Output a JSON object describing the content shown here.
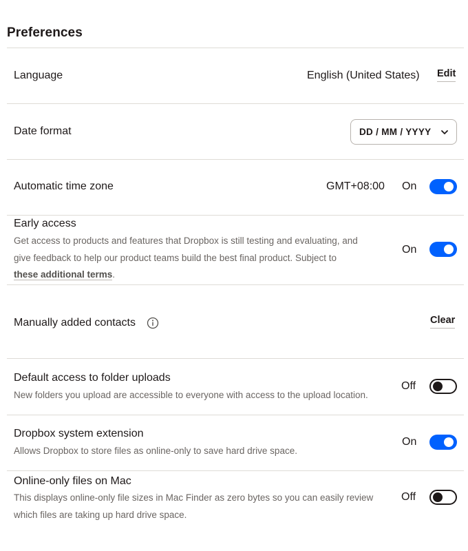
{
  "title": "Preferences",
  "language": {
    "label": "Language",
    "value": "English (United States)",
    "edit_label": "Edit"
  },
  "date_format": {
    "label": "Date format",
    "selected": "DD / MM / YYYY"
  },
  "time_zone": {
    "label": "Automatic time zone",
    "value": "GMT+08:00",
    "state": "On",
    "enabled": true
  },
  "early_access": {
    "label": "Early access",
    "desc_line1": "Get access to products and features that Dropbox is still testing and evaluating, and",
    "desc_line2": "give feedback to help our product teams build the best final product. Subject to",
    "terms_link": "these additional terms",
    "terms_suffix": ".",
    "state": "On",
    "enabled": true
  },
  "contacts": {
    "label": "Manually added contacts",
    "clear_label": "Clear"
  },
  "folder_uploads": {
    "label": "Default access to folder uploads",
    "desc": "New folders you upload are accessible to everyone with access to the upload location.",
    "state": "Off",
    "enabled": false
  },
  "system_extension": {
    "label": "Dropbox system extension",
    "desc": "Allows Dropbox to store files as online-only to save hard drive space.",
    "state": "On",
    "enabled": true
  },
  "online_only": {
    "label": "Online-only files on Mac",
    "desc_line1": "This displays online-only file sizes in Mac Finder as zero bytes so you can easily review",
    "desc_line2": "which files are taking up hard drive space.",
    "state": "Off",
    "enabled": false
  },
  "colors": {
    "accent": "#0061fe",
    "text": "#1e1919",
    "muted": "#6a6562",
    "divider": "#dedbd6"
  }
}
